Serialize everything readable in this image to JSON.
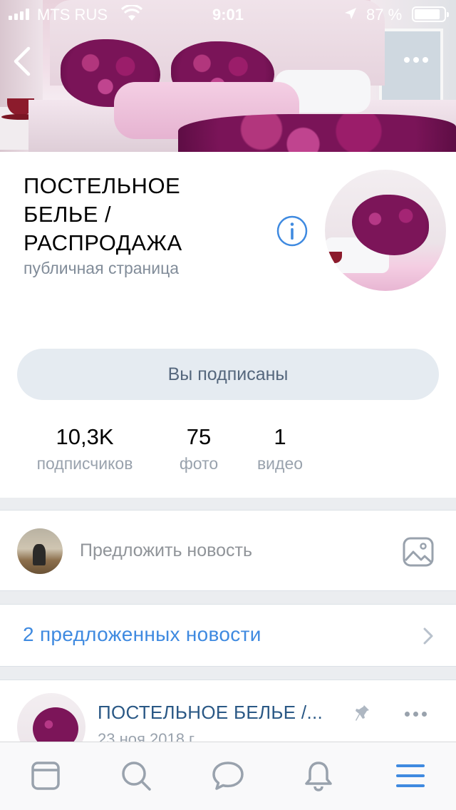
{
  "status_bar": {
    "carrier": "MTS RUS",
    "time": "9:01",
    "battery_percent": "87 %",
    "battery_level": 0.87
  },
  "header": {
    "back_icon": "chevron-left-icon",
    "more_icon": "more-horizontal-icon"
  },
  "group": {
    "title": "ПОСТЕЛЬНОЕ БЕЛЬЕ / РАСПРОДАЖА",
    "type": "публичная страница",
    "info_icon": "info-icon",
    "subscribe_label": "Вы подписаны"
  },
  "counters": [
    {
      "value": "10,3K",
      "label": "подписчиков"
    },
    {
      "value": "75",
      "label": "фото"
    },
    {
      "value": "1",
      "label": "видео"
    }
  ],
  "suggest": {
    "placeholder": "Предложить новость",
    "photo_icon": "image-icon"
  },
  "suggested_news": {
    "text": "2 предложенных новости"
  },
  "post": {
    "author": "ПОСТЕЛЬНОЕ БЕЛЬЕ /...",
    "date": "23 ноя 2018 г."
  },
  "tabbar": {
    "items": [
      "news-icon",
      "search-icon",
      "messages-icon",
      "notifications-icon",
      "menu-icon"
    ],
    "active_color": "#3f8ae0",
    "inactive_color": "#99a2ad"
  },
  "colors": {
    "accent": "#3f8ae0",
    "link": "#2a5885",
    "subscribe_bg": "#e5ebf1",
    "subscribe_text": "#55677d"
  }
}
